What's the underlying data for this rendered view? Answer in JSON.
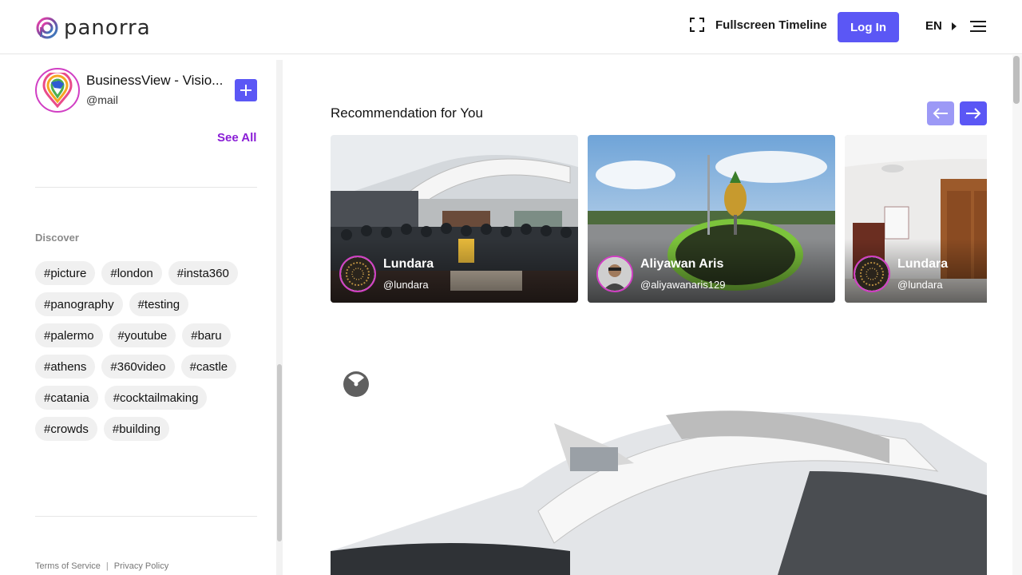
{
  "header": {
    "brand": "panorra",
    "fullscreen_label": "Fullscreen Timeline",
    "login_label": "Log In",
    "language": "EN"
  },
  "sidebar": {
    "account": {
      "name": "BusinessView - Visio...",
      "handle": "@mail"
    },
    "see_all_label": "See All",
    "discover_label": "Discover",
    "tags": [
      "#picture",
      "#london",
      "#insta360",
      "#panography",
      "#testing",
      "#palermo",
      "#youtube",
      "#baru",
      "#athens",
      "#360video",
      "#castle",
      "#catania",
      "#cocktailmaking",
      "#crowds",
      "#building"
    ],
    "footer": {
      "terms": "Terms of Service",
      "separator": "|",
      "privacy": "Privacy Policy"
    }
  },
  "main": {
    "recommendation_title": "Recommendation for You",
    "cards": [
      {
        "name": "Lundara",
        "handle": "@lundara"
      },
      {
        "name": "Aliyawan Aris",
        "handle": "@aliyawanaris129"
      },
      {
        "name": "Lundara",
        "handle": "@lundara"
      }
    ]
  },
  "colors": {
    "accent": "#5b57f5",
    "accent_light": "#9c99f6",
    "see_all": "#8a1ed6",
    "avatar_ring": "#d13fc4"
  }
}
